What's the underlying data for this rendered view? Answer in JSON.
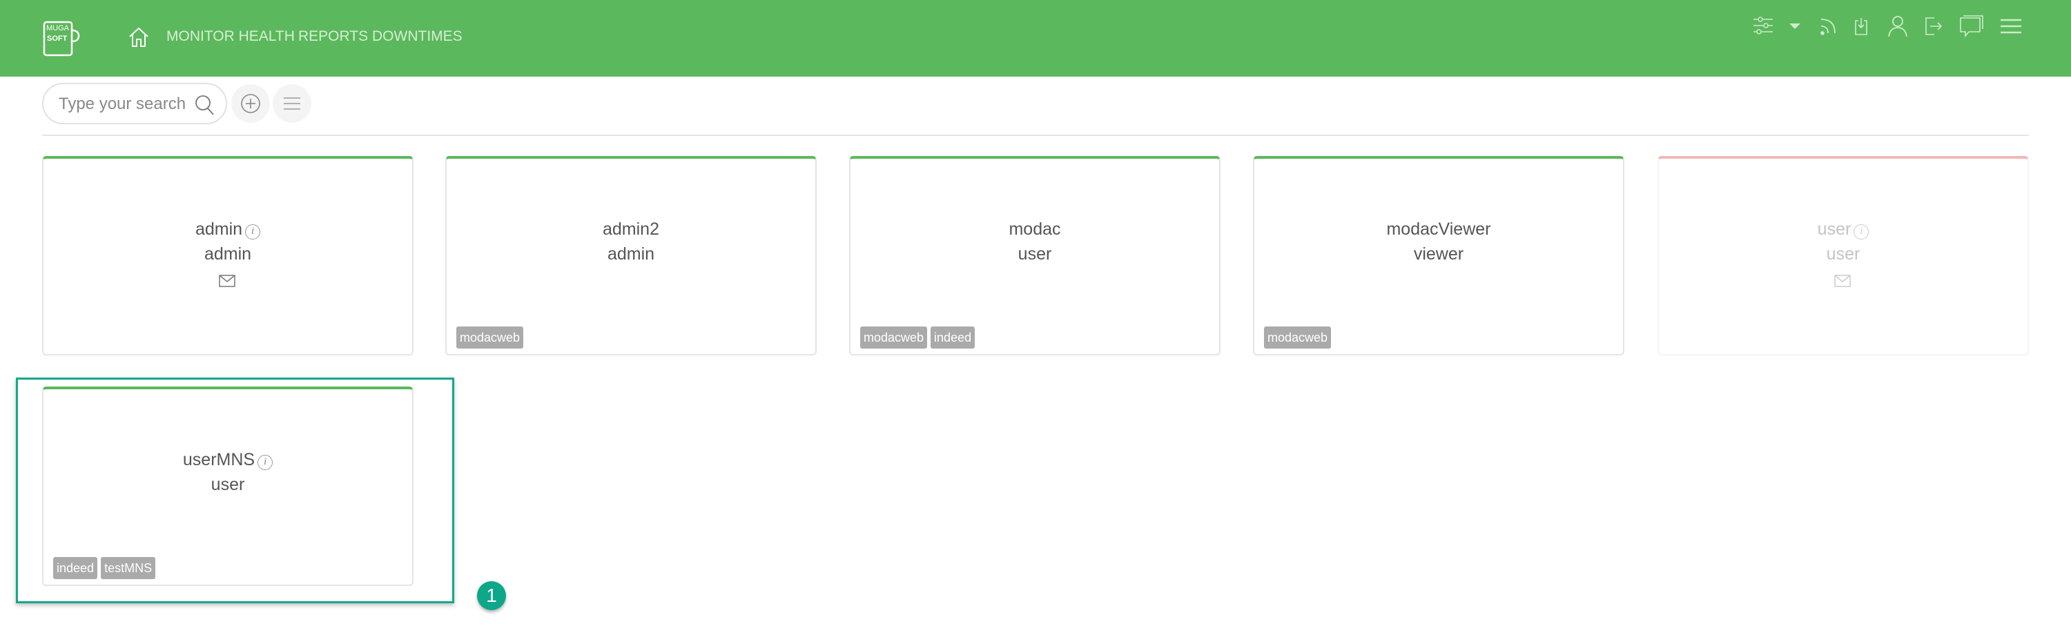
{
  "header": {
    "logo_text": "MUGA SOFT",
    "nav": [
      {
        "label": "MONITOR HEALTH"
      },
      {
        "label": "REPORTS"
      },
      {
        "label": "DOWNTIMES"
      }
    ],
    "right_icons": [
      "sliders-icon",
      "caret-down-icon",
      "rss-icon",
      "download-icon",
      "user-icon",
      "logout-icon",
      "chat-icon",
      "menu-icon"
    ]
  },
  "toolbar": {
    "search_placeholder": "Type your search"
  },
  "cards": [
    {
      "name": "admin",
      "role": "admin",
      "info": true,
      "email": true,
      "tags": [],
      "status": "active"
    },
    {
      "name": "admin2",
      "role": "admin",
      "info": false,
      "email": false,
      "tags": [
        "modacweb"
      ],
      "status": "active"
    },
    {
      "name": "modac",
      "role": "user",
      "info": false,
      "email": false,
      "tags": [
        "modacweb",
        "indeed"
      ],
      "status": "active"
    },
    {
      "name": "modacViewer",
      "role": "viewer",
      "info": false,
      "email": false,
      "tags": [
        "modacweb"
      ],
      "status": "active"
    },
    {
      "name": "user",
      "role": "user",
      "info": true,
      "email": true,
      "tags": [],
      "status": "inactive"
    },
    {
      "name": "userMNS",
      "role": "user",
      "info": true,
      "email": false,
      "tags": [
        "indeed",
        "testMNS"
      ],
      "status": "active"
    }
  ],
  "annotation": {
    "marker_label": "1"
  },
  "colors": {
    "header": "#5cb85c",
    "active_border": "#5cb85c",
    "inactive_border": "#f0b8b8",
    "tag": "#aaaaaa",
    "highlight": "#13a88a"
  }
}
